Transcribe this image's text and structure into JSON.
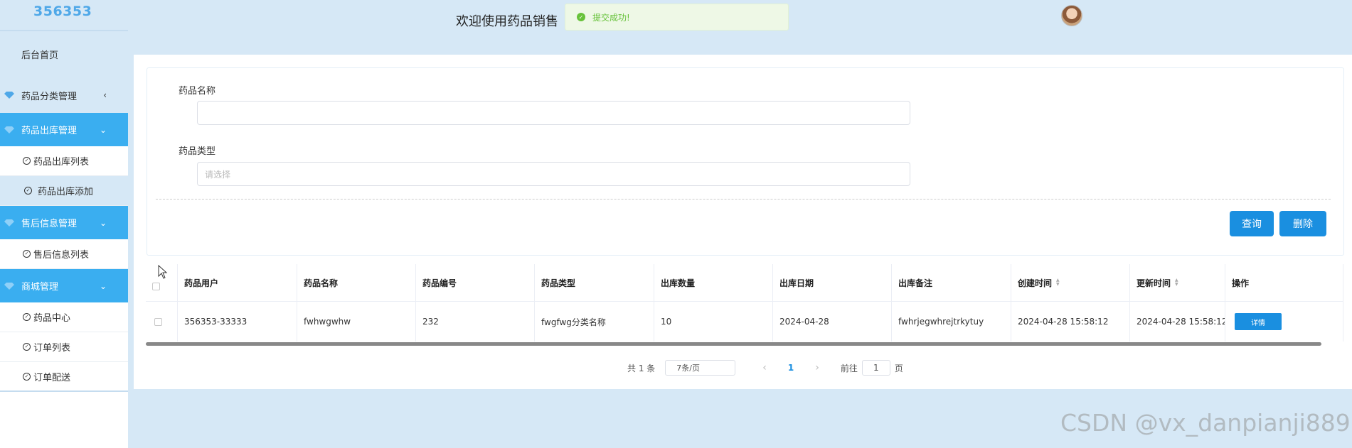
{
  "sidebar": {
    "logo": "356353",
    "home": "后台首页",
    "groups": [
      {
        "label": "药品分类管理",
        "state": "collapsed",
        "chevron": "‹"
      },
      {
        "label": "药品出库管理",
        "state": "open",
        "chevron": "⌄",
        "items": [
          "药品出库列表",
          "药品出库添加"
        ]
      },
      {
        "label": "售后信息管理",
        "state": "open",
        "chevron": "⌄",
        "items": [
          "售后信息列表"
        ]
      },
      {
        "label": "商城管理",
        "state": "open",
        "chevron": "⌄",
        "items": [
          "药品中心",
          "订单列表",
          "订单配送"
        ]
      }
    ]
  },
  "header": {
    "title": "欢迎使用药品销售",
    "toast": "提交成功!"
  },
  "form": {
    "name_label": "药品名称",
    "name_value": "",
    "type_label": "药品类型",
    "type_placeholder": "请选择",
    "query_button": "查询",
    "delete_button": "删除"
  },
  "table": {
    "columns": [
      "药品用户",
      "药品名称",
      "药品编号",
      "药品类型",
      "出库数量",
      "出库日期",
      "出库备注",
      "创建时间",
      "更新时间",
      "操作"
    ],
    "rows": [
      [
        "356353-33333",
        "fwhwgwhw",
        "232",
        "fwgfwg分类名称",
        "10",
        "2024-04-28",
        "fwhrjegwhrejtrkytuy",
        "2024-04-28 15:58:12",
        "2024-04-28 15:58:12"
      ]
    ],
    "action_label": "详情"
  },
  "pager": {
    "total": "共 1 条",
    "page_size": "7条/页",
    "current": "1",
    "goto_prefix": "前往",
    "goto_value": "1",
    "goto_suffix": "页"
  },
  "watermark": "CSDN @vx_danpianji889",
  "colors": {
    "accent": "#3aaef0",
    "button": "#1a8fe0",
    "background": "#d6e8f6",
    "success": "#67c23a"
  }
}
